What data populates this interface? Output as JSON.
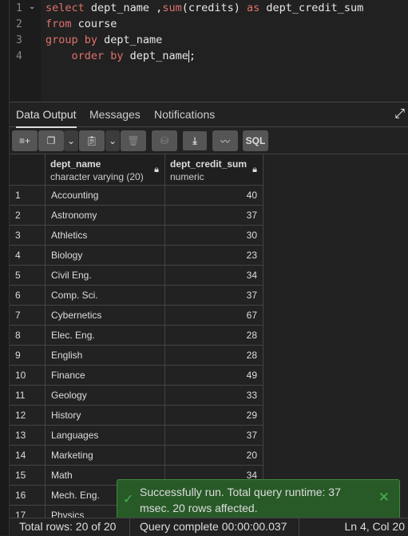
{
  "editor": {
    "line_numbers": [
      "1",
      "2",
      "3",
      "4"
    ],
    "lines": [
      [
        {
          "t": "select",
          "k": true
        },
        {
          "t": " dept_name ,",
          "k": false
        },
        {
          "t": "sum",
          "k": true
        },
        {
          "t": "(credits) ",
          "k": false
        },
        {
          "t": "as",
          "k": true
        },
        {
          "t": " dept_credit_sum",
          "k": false
        }
      ],
      [
        {
          "t": "from",
          "k": true
        },
        {
          "t": " course",
          "k": false
        }
      ],
      [
        {
          "t": "group by",
          "k": true
        },
        {
          "t": " dept_name",
          "k": false
        }
      ],
      [
        {
          "t": "    order by",
          "k": true
        },
        {
          "t": " dept_name",
          "k": false
        },
        {
          "t": ";",
          "k": false
        }
      ]
    ]
  },
  "tabs": [
    "Data Output",
    "Messages",
    "Notifications"
  ],
  "toolbar": {
    "sql_label": "SQL"
  },
  "columns": [
    {
      "name": "dept_name",
      "type": "character varying (20)"
    },
    {
      "name": "dept_credit_sum",
      "type": "numeric"
    }
  ],
  "rows": [
    [
      "1",
      "Accounting",
      "40"
    ],
    [
      "2",
      "Astronomy",
      "37"
    ],
    [
      "3",
      "Athletics",
      "30"
    ],
    [
      "4",
      "Biology",
      "23"
    ],
    [
      "5",
      "Civil Eng.",
      "34"
    ],
    [
      "6",
      "Comp. Sci.",
      "37"
    ],
    [
      "7",
      "Cybernetics",
      "67"
    ],
    [
      "8",
      "Elec. Eng.",
      "28"
    ],
    [
      "9",
      "English",
      "28"
    ],
    [
      "10",
      "Finance",
      "49"
    ],
    [
      "11",
      "Geology",
      "33"
    ],
    [
      "12",
      "History",
      "29"
    ],
    [
      "13",
      "Languages",
      "37"
    ],
    [
      "14",
      "Marketing",
      "20"
    ],
    [
      "15",
      "Math",
      "34"
    ],
    [
      "16",
      "Mech. Eng.",
      ""
    ],
    [
      "17",
      "Physics",
      ""
    ]
  ],
  "toast": {
    "message": "Successfully run. Total query runtime: 37 msec. 20 rows affected.",
    "color": "#285a28"
  },
  "status": {
    "total_rows": "Total rows: 20 of 20",
    "query": "Query complete 00:00:00.037",
    "position": "Ln 4, Col 20"
  }
}
